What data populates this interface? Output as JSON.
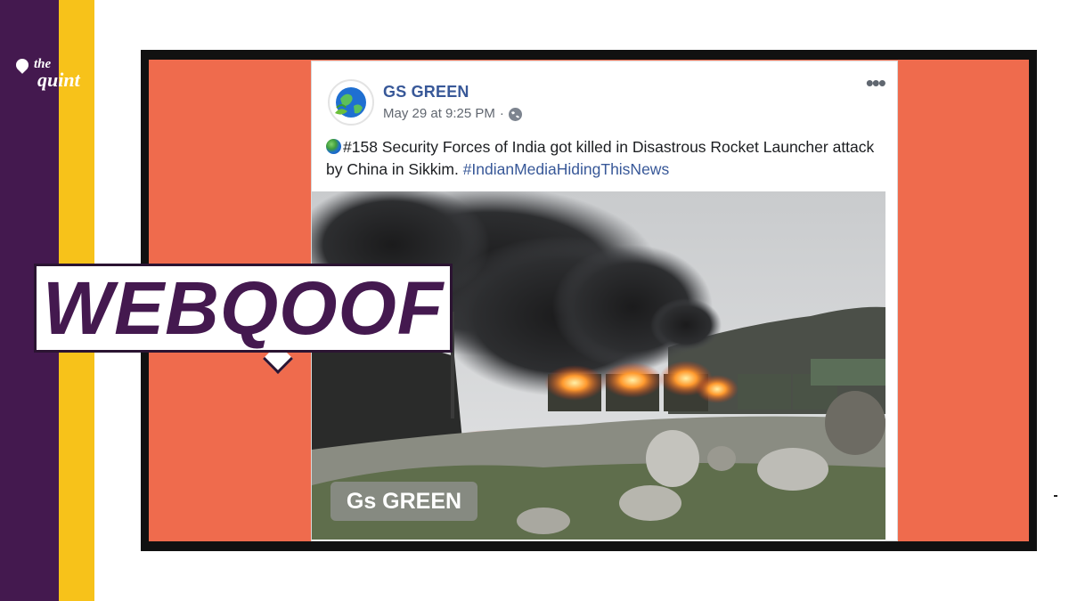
{
  "brand": {
    "logo_line1": "the",
    "logo_line2": "quint",
    "colors": {
      "purple": "#44194f",
      "yellow": "#f7c21a"
    }
  },
  "post": {
    "author": "GS GREEN",
    "timestamp": "May 29 at 9:25 PM",
    "separator": "·",
    "privacy_icon": "globe-icon",
    "more_icon": "more-options-icon",
    "text": "#158 Security Forces of India got killed in Disastrous Rocket Launcher attack by China in Sikkim.",
    "hashtag": "#IndianMediaHidingThisNews",
    "more_label": "•••"
  },
  "photo": {
    "watermark": "Gs GREEN"
  },
  "banner": {
    "label": "WEBQOOF"
  },
  "colors": {
    "salmon": "#ef6b4d",
    "link": "#385898"
  }
}
